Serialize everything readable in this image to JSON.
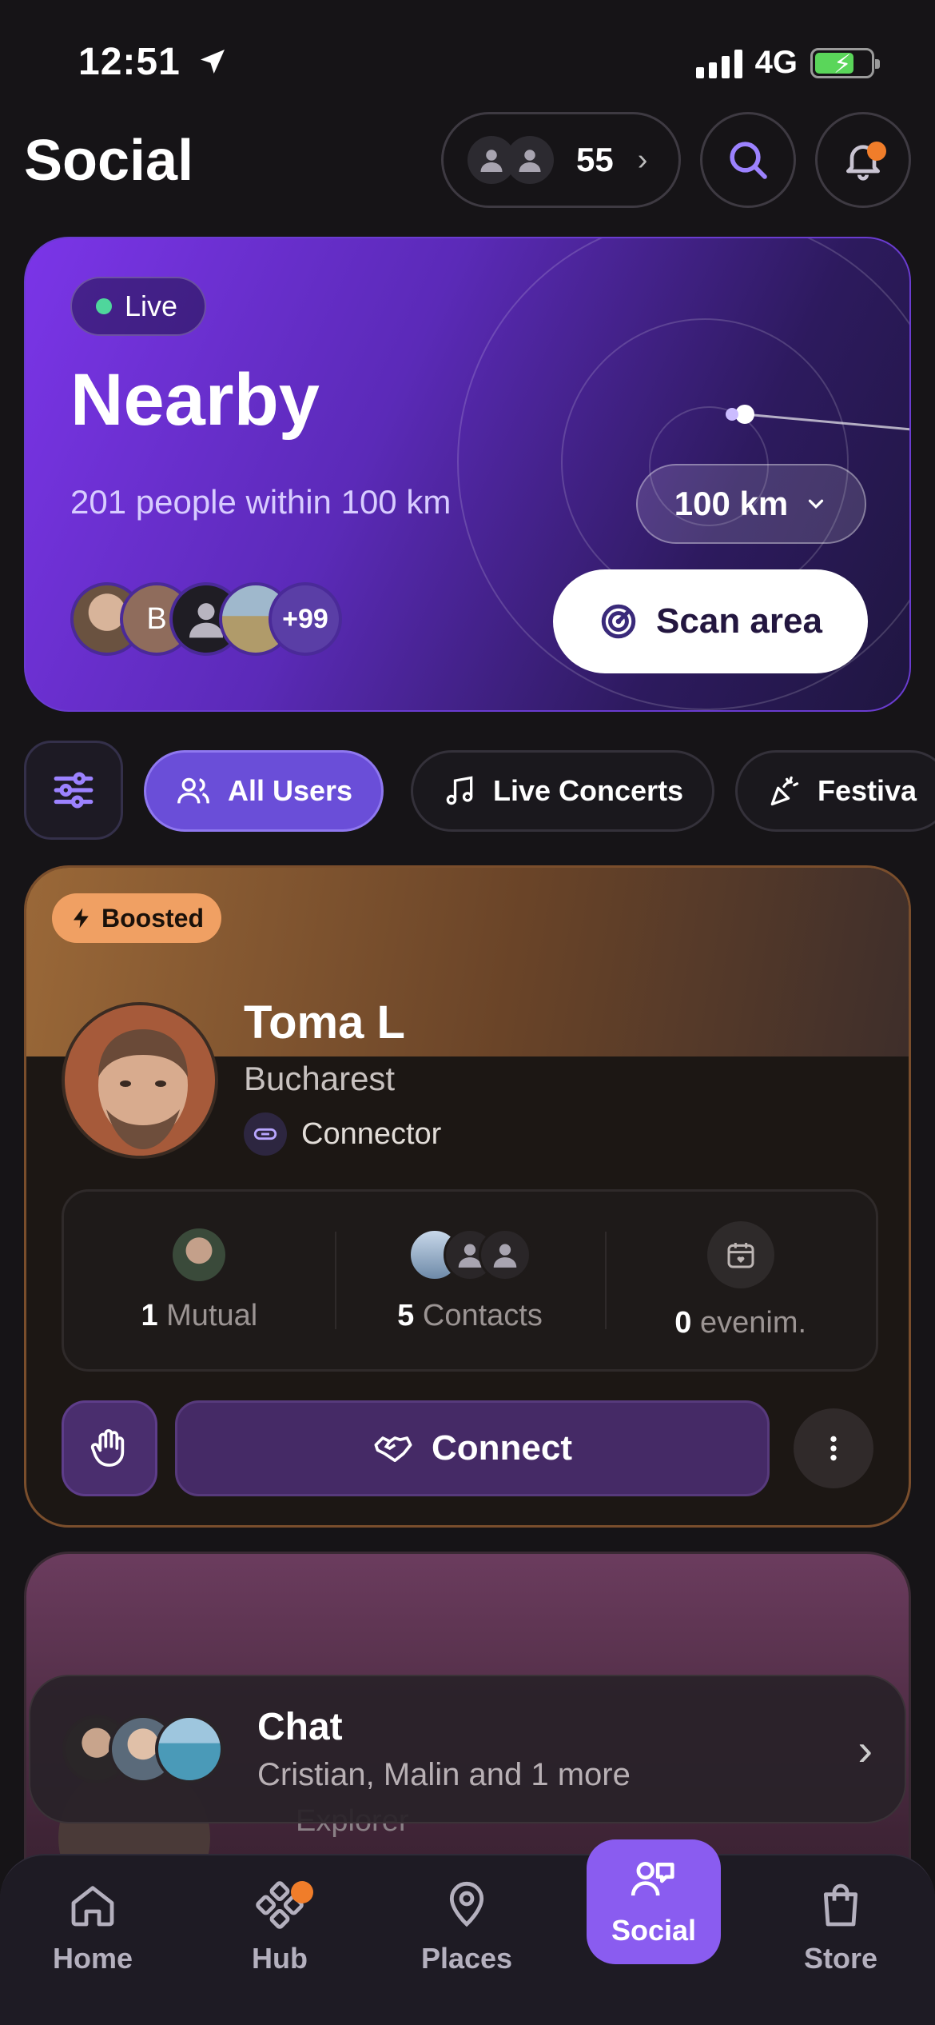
{
  "status_bar": {
    "time": "12:51",
    "network": "4G"
  },
  "header": {
    "title": "Social",
    "friends_count": "55",
    "icons": [
      "search-icon",
      "bell-icon"
    ]
  },
  "nearby": {
    "live_label": "Live",
    "title": "Nearby",
    "subtitle": "201 people within 100 km",
    "radius": "100 km",
    "scan_label": "Scan area",
    "avatar_initial": "B",
    "more_count": "+99"
  },
  "filters": {
    "chips": [
      "All Users",
      "Live Concerts",
      "Festiva"
    ]
  },
  "profile": {
    "badge": "Boosted",
    "name": "Toma L",
    "city": "Bucharest",
    "role": "Connector",
    "stats": {
      "mutual_count": "1",
      "mutual_label": "Mutual",
      "contacts_count": "5",
      "contacts_label": "Contacts",
      "events_count": "0",
      "events_label": "evenim."
    },
    "connect_label": "Connect"
  },
  "second_card": {
    "role": "Explorer"
  },
  "chat": {
    "title": "Chat",
    "subtitle": "Cristian, Malin and 1 more"
  },
  "tabs": {
    "home": "Home",
    "hub": "Hub",
    "places": "Places",
    "social": "Social",
    "store": "Store"
  },
  "colors": {
    "background": "#161417",
    "accent": "#8a5cf0",
    "boost": "#f0a063",
    "live": "#4fd69c",
    "notification": "#f07d2a"
  }
}
